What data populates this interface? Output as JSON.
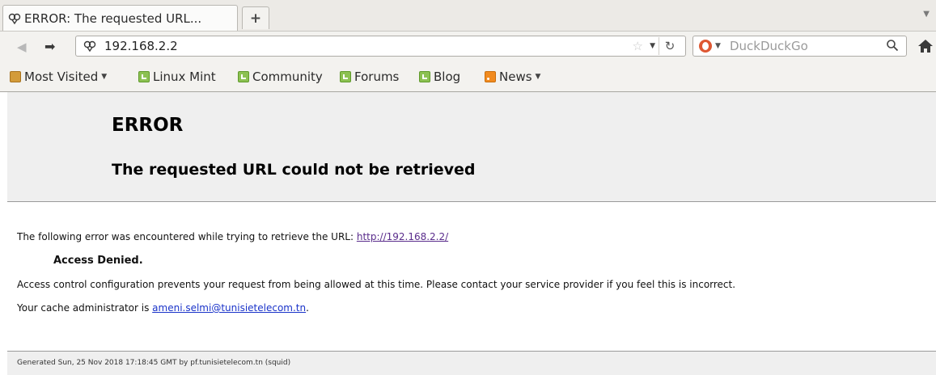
{
  "tab": {
    "title": "ERROR: The requested URL...",
    "favicon": "generic-site-icon",
    "new_tab_label": "+"
  },
  "nav": {
    "back_icon": "back-arrow-icon",
    "forward_icon": "forward-arrow-icon",
    "url": "192.168.2.2",
    "search_engine": "DuckDuckGo",
    "search_placeholder": "DuckDuckGo"
  },
  "bookmarks": [
    {
      "label": "Most Visited",
      "icon": "folder-icon",
      "has_dropdown": true
    },
    {
      "label": "Linux Mint",
      "icon": "mint-icon"
    },
    {
      "label": "Community",
      "icon": "mint-icon"
    },
    {
      "label": "Forums",
      "icon": "mint-icon"
    },
    {
      "label": "Blog",
      "icon": "mint-icon"
    },
    {
      "label": "News",
      "icon": "rss-icon",
      "has_dropdown": true
    }
  ],
  "page": {
    "title": "ERROR",
    "subtitle": "The requested URL could not be retrieved",
    "intro": "The following error was encountered while trying to retrieve the URL: ",
    "url_link": "http://192.168.2.2/",
    "error_name": "Access Denied.",
    "explanation": "Access control configuration prevents your request from being allowed at this time. Please contact your service provider if you feel this is incorrect.",
    "admin_prefix": "Your cache administrator is ",
    "admin_email": "ameni.selmi@tunisietelecom.tn",
    "admin_suffix": ".",
    "footer": "Generated Sun, 25 Nov 2018 17:18:45 GMT by pf.tunisietelecom.tn (squid)"
  },
  "colors": {
    "banner_bg": "#efefef",
    "visited_link": "#5a2d8c",
    "mail_link": "#1a33c9",
    "chrome_bg": "#f3f2ef"
  }
}
